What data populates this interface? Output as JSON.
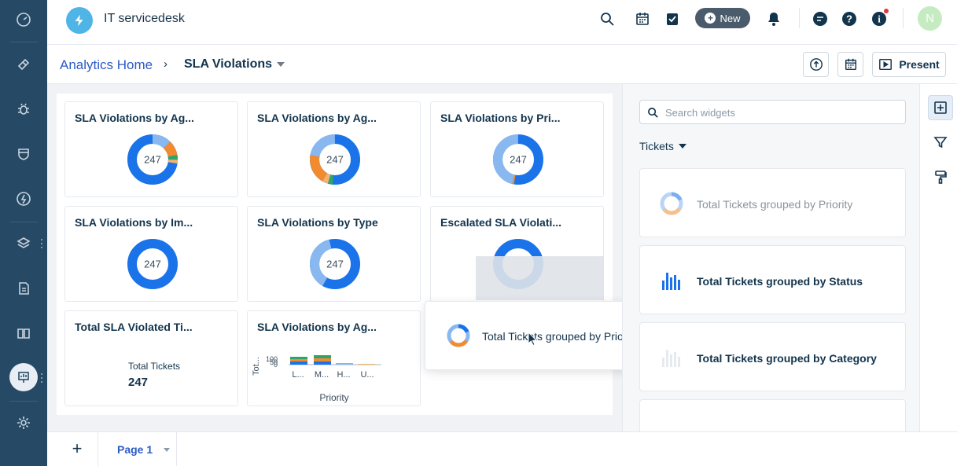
{
  "app": {
    "title": "IT servicedesk"
  },
  "header": {
    "new_label": "New",
    "avatar_initial": "N"
  },
  "breadcrumb": {
    "home": "Analytics Home",
    "separator": "›",
    "current": "SLA Violations"
  },
  "actions": {
    "present_label": "Present"
  },
  "widgets": [
    {
      "title": "SLA Violations by Ag...",
      "value": "247",
      "type": "donut"
    },
    {
      "title": "SLA Violations by Ag...",
      "value": "247",
      "type": "donut"
    },
    {
      "title": "SLA Violations by Pri...",
      "value": "247",
      "type": "donut"
    },
    {
      "title": "SLA Violations by Im...",
      "value": "247",
      "type": "donut"
    },
    {
      "title": "SLA Violations by Type",
      "value": "247",
      "type": "donut"
    },
    {
      "title": "Escalated SLA Violati...",
      "value": "",
      "type": "donut"
    },
    {
      "title": "Total SLA Violated Ti...",
      "metric_label": "Total Tickets",
      "value": "247",
      "type": "metric"
    },
    {
      "title": "SLA Violations by Ag...",
      "type": "bar",
      "ylabel": "Tot...",
      "xlabel": "Priority",
      "y_ticks": [
        "100",
        "50",
        "0"
      ],
      "x_ticks": [
        "L...",
        "M...",
        "H...",
        "U..."
      ]
    }
  ],
  "dragging": {
    "label": "Total Tickets grouped by Priority"
  },
  "panel": {
    "search_placeholder": "Search widgets",
    "category": "Tickets",
    "items": [
      {
        "label": "Total Tickets grouped by Priority",
        "icon": "donut-icon"
      },
      {
        "label": "Total Tickets grouped by Status",
        "icon": "bar-chart-icon"
      },
      {
        "label": "Total Tickets grouped by Category",
        "icon": "bar-chart-icon"
      }
    ]
  },
  "footer": {
    "add_label": "+",
    "page_label": "Page 1"
  },
  "colors": {
    "accent": "#2c5cc5",
    "rail": "#264966",
    "blue": "#1a73e8",
    "orange": "#f28b30",
    "green": "#2ea56b",
    "light_blue": "#89b8f0"
  }
}
